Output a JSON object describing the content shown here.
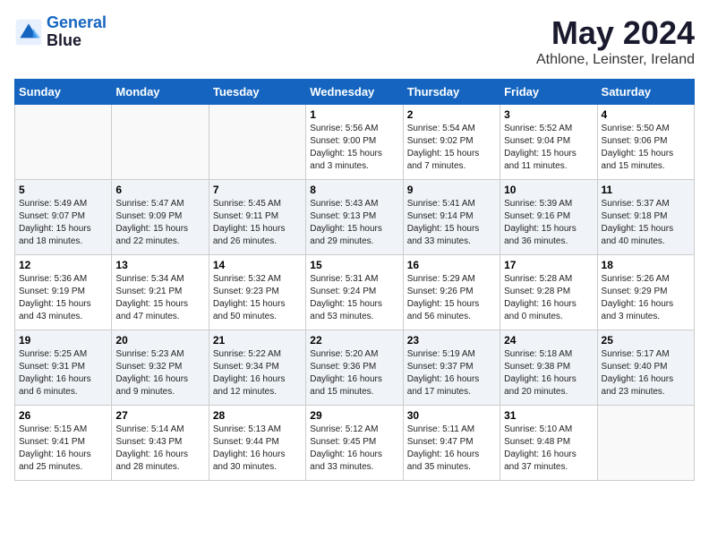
{
  "header": {
    "logo_line1": "General",
    "logo_line2": "Blue",
    "title": "May 2024",
    "subtitle": "Athlone, Leinster, Ireland"
  },
  "days_of_week": [
    "Sunday",
    "Monday",
    "Tuesday",
    "Wednesday",
    "Thursday",
    "Friday",
    "Saturday"
  ],
  "weeks": [
    [
      {
        "day": "",
        "info": ""
      },
      {
        "day": "",
        "info": ""
      },
      {
        "day": "",
        "info": ""
      },
      {
        "day": "1",
        "info": "Sunrise: 5:56 AM\nSunset: 9:00 PM\nDaylight: 15 hours\nand 3 minutes."
      },
      {
        "day": "2",
        "info": "Sunrise: 5:54 AM\nSunset: 9:02 PM\nDaylight: 15 hours\nand 7 minutes."
      },
      {
        "day": "3",
        "info": "Sunrise: 5:52 AM\nSunset: 9:04 PM\nDaylight: 15 hours\nand 11 minutes."
      },
      {
        "day": "4",
        "info": "Sunrise: 5:50 AM\nSunset: 9:06 PM\nDaylight: 15 hours\nand 15 minutes."
      }
    ],
    [
      {
        "day": "5",
        "info": "Sunrise: 5:49 AM\nSunset: 9:07 PM\nDaylight: 15 hours\nand 18 minutes."
      },
      {
        "day": "6",
        "info": "Sunrise: 5:47 AM\nSunset: 9:09 PM\nDaylight: 15 hours\nand 22 minutes."
      },
      {
        "day": "7",
        "info": "Sunrise: 5:45 AM\nSunset: 9:11 PM\nDaylight: 15 hours\nand 26 minutes."
      },
      {
        "day": "8",
        "info": "Sunrise: 5:43 AM\nSunset: 9:13 PM\nDaylight: 15 hours\nand 29 minutes."
      },
      {
        "day": "9",
        "info": "Sunrise: 5:41 AM\nSunset: 9:14 PM\nDaylight: 15 hours\nand 33 minutes."
      },
      {
        "day": "10",
        "info": "Sunrise: 5:39 AM\nSunset: 9:16 PM\nDaylight: 15 hours\nand 36 minutes."
      },
      {
        "day": "11",
        "info": "Sunrise: 5:37 AM\nSunset: 9:18 PM\nDaylight: 15 hours\nand 40 minutes."
      }
    ],
    [
      {
        "day": "12",
        "info": "Sunrise: 5:36 AM\nSunset: 9:19 PM\nDaylight: 15 hours\nand 43 minutes."
      },
      {
        "day": "13",
        "info": "Sunrise: 5:34 AM\nSunset: 9:21 PM\nDaylight: 15 hours\nand 47 minutes."
      },
      {
        "day": "14",
        "info": "Sunrise: 5:32 AM\nSunset: 9:23 PM\nDaylight: 15 hours\nand 50 minutes."
      },
      {
        "day": "15",
        "info": "Sunrise: 5:31 AM\nSunset: 9:24 PM\nDaylight: 15 hours\nand 53 minutes."
      },
      {
        "day": "16",
        "info": "Sunrise: 5:29 AM\nSunset: 9:26 PM\nDaylight: 15 hours\nand 56 minutes."
      },
      {
        "day": "17",
        "info": "Sunrise: 5:28 AM\nSunset: 9:28 PM\nDaylight: 16 hours\nand 0 minutes."
      },
      {
        "day": "18",
        "info": "Sunrise: 5:26 AM\nSunset: 9:29 PM\nDaylight: 16 hours\nand 3 minutes."
      }
    ],
    [
      {
        "day": "19",
        "info": "Sunrise: 5:25 AM\nSunset: 9:31 PM\nDaylight: 16 hours\nand 6 minutes."
      },
      {
        "day": "20",
        "info": "Sunrise: 5:23 AM\nSunset: 9:32 PM\nDaylight: 16 hours\nand 9 minutes."
      },
      {
        "day": "21",
        "info": "Sunrise: 5:22 AM\nSunset: 9:34 PM\nDaylight: 16 hours\nand 12 minutes."
      },
      {
        "day": "22",
        "info": "Sunrise: 5:20 AM\nSunset: 9:36 PM\nDaylight: 16 hours\nand 15 minutes."
      },
      {
        "day": "23",
        "info": "Sunrise: 5:19 AM\nSunset: 9:37 PM\nDaylight: 16 hours\nand 17 minutes."
      },
      {
        "day": "24",
        "info": "Sunrise: 5:18 AM\nSunset: 9:38 PM\nDaylight: 16 hours\nand 20 minutes."
      },
      {
        "day": "25",
        "info": "Sunrise: 5:17 AM\nSunset: 9:40 PM\nDaylight: 16 hours\nand 23 minutes."
      }
    ],
    [
      {
        "day": "26",
        "info": "Sunrise: 5:15 AM\nSunset: 9:41 PM\nDaylight: 16 hours\nand 25 minutes."
      },
      {
        "day": "27",
        "info": "Sunrise: 5:14 AM\nSunset: 9:43 PM\nDaylight: 16 hours\nand 28 minutes."
      },
      {
        "day": "28",
        "info": "Sunrise: 5:13 AM\nSunset: 9:44 PM\nDaylight: 16 hours\nand 30 minutes."
      },
      {
        "day": "29",
        "info": "Sunrise: 5:12 AM\nSunset: 9:45 PM\nDaylight: 16 hours\nand 33 minutes."
      },
      {
        "day": "30",
        "info": "Sunrise: 5:11 AM\nSunset: 9:47 PM\nDaylight: 16 hours\nand 35 minutes."
      },
      {
        "day": "31",
        "info": "Sunrise: 5:10 AM\nSunset: 9:48 PM\nDaylight: 16 hours\nand 37 minutes."
      },
      {
        "day": "",
        "info": ""
      }
    ]
  ]
}
